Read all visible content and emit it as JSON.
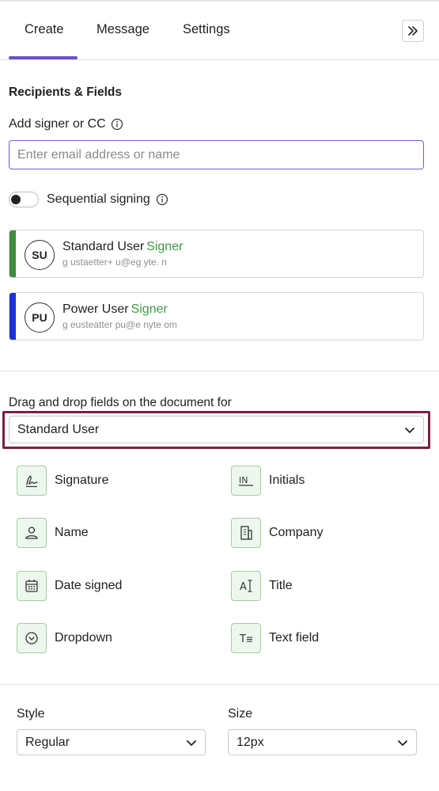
{
  "tabs": [
    {
      "label": "Create"
    },
    {
      "label": "Message"
    },
    {
      "label": "Settings"
    }
  ],
  "section_title": "Recipients & Fields",
  "add_signer": {
    "label": "Add signer or CC",
    "placeholder": "Enter email address or name"
  },
  "sequential": {
    "label": "Sequential signing"
  },
  "recipients": [
    {
      "initials": "SU",
      "name": "Standard User",
      "role": "Signer",
      "email": "g ustaetter+ u@eg yte. n",
      "color": "#3e8e3a"
    },
    {
      "initials": "PU",
      "name": "Power User",
      "role": "Signer",
      "email": "g eusteatter pu@e nyte om",
      "color": "#1a33d8"
    }
  ],
  "drag_drop": {
    "label": "Drag and drop fields on the document for",
    "selected": "Standard User"
  },
  "fields": [
    {
      "label": "Signature",
      "icon": "signature-icon"
    },
    {
      "label": "Initials",
      "icon": "initials-icon"
    },
    {
      "label": "Name",
      "icon": "person-icon"
    },
    {
      "label": "Company",
      "icon": "building-icon"
    },
    {
      "label": "Date signed",
      "icon": "calendar-icon"
    },
    {
      "label": "Title",
      "icon": "text-cursor-icon"
    },
    {
      "label": "Dropdown",
      "icon": "dropdown-circle-icon"
    },
    {
      "label": "Text field",
      "icon": "text-field-icon"
    }
  ],
  "style": {
    "label": "Style",
    "value": "Regular"
  },
  "size": {
    "label": "Size",
    "value": "12px"
  },
  "colors": {
    "accent": "#6a52c9",
    "signer_green": "#3f9a45",
    "highlight": "#7b1f44"
  }
}
